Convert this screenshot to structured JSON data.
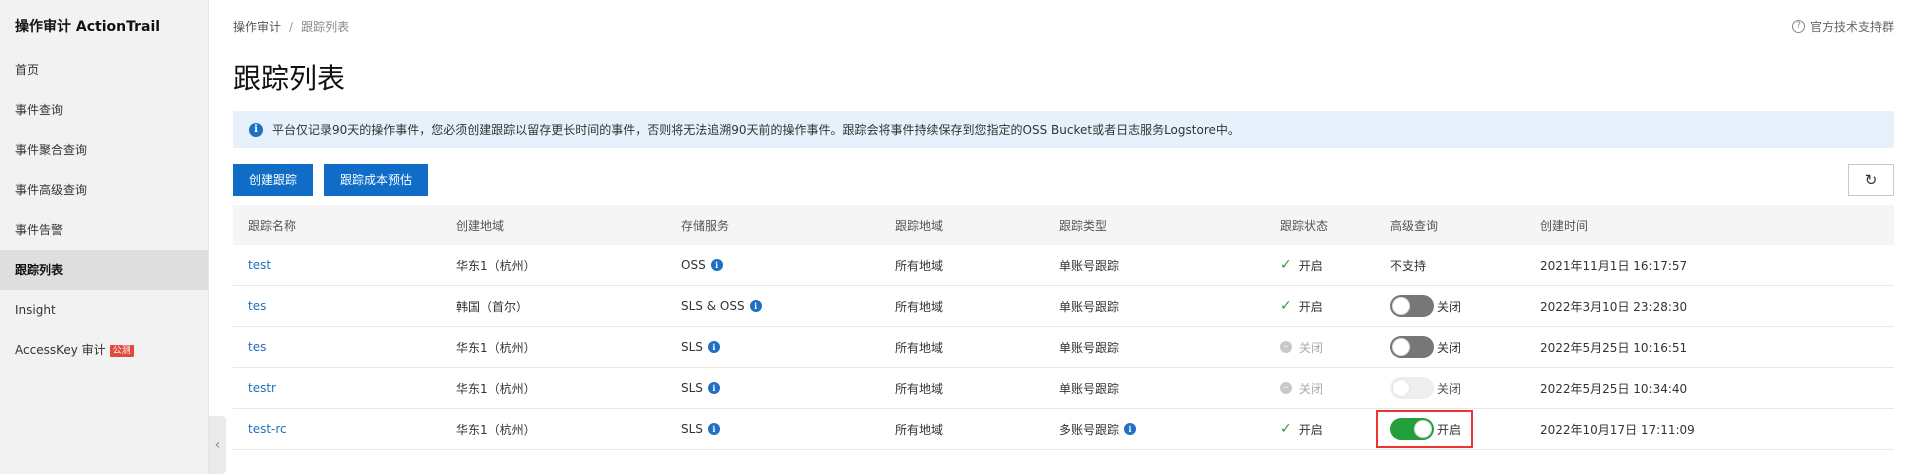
{
  "app": {
    "title": "操作审计 ActionTrail"
  },
  "sidebar": {
    "items": [
      {
        "label": "首页"
      },
      {
        "label": "事件查询"
      },
      {
        "label": "事件聚合查询"
      },
      {
        "label": "事件高级查询"
      },
      {
        "label": "事件告警"
      },
      {
        "label": "跟踪列表",
        "active": true
      },
      {
        "label": "Insight"
      },
      {
        "label": "AccessKey 审计",
        "badge": "公测"
      }
    ]
  },
  "breadcrumb": {
    "root": "操作审计",
    "separator": "/",
    "current": "跟踪列表"
  },
  "support": {
    "label": "官方技术支持群",
    "icon": "question-icon"
  },
  "page": {
    "title": "跟踪列表"
  },
  "notice": {
    "text": "平台仅记录90天的操作事件，您必须创建跟踪以留存更长时间的事件，否则将无法追溯90天前的操作事件。跟踪会将事件持续保存到您指定的OSS Bucket或者日志服务Logstore中。"
  },
  "toolbar": {
    "create_label": "创建跟踪",
    "estimate_label": "跟踪成本预估",
    "refresh_icon": "refresh-icon"
  },
  "table": {
    "headers": [
      "跟踪名称",
      "创建地域",
      "存储服务",
      "跟踪地域",
      "跟踪类型",
      "跟踪状态",
      "高级查询",
      "创建时间"
    ],
    "rows": [
      {
        "name": "test",
        "region": "华东1（杭州）",
        "storage": "OSS",
        "trail_region": "所有地域",
        "type": "单账号跟踪",
        "status": "开启",
        "advanced": "不支持",
        "created": "2021年11月1日 16:17:57"
      },
      {
        "name": "tes",
        "region": "韩国（首尔）",
        "storage": "SLS & OSS",
        "trail_region": "所有地域",
        "type": "单账号跟踪",
        "status": "开启",
        "advanced": "关闭",
        "created": "2022年3月10日 23:28:30"
      },
      {
        "name": "tes",
        "region": "华东1（杭州）",
        "storage": "SLS",
        "trail_region": "所有地域",
        "type": "单账号跟踪",
        "status": "关闭",
        "advanced": "关闭",
        "created": "2022年5月25日 10:16:51"
      },
      {
        "name": "testr",
        "region": "华东1（杭州）",
        "storage": "SLS",
        "trail_region": "所有地域",
        "type": "单账号跟踪",
        "status": "关闭",
        "advanced": "关闭",
        "created": "2022年5月25日 10:34:40"
      },
      {
        "name": "test-rc",
        "region": "华东1（杭州）",
        "storage": "SLS",
        "trail_region": "所有地域",
        "type": "多账号跟踪",
        "status": "开启",
        "advanced": "开启",
        "created": "2022年10月17日 17:11:09"
      }
    ]
  },
  "colors": {
    "primary": "#0f6dc8",
    "success": "#23a03c",
    "notice_bg": "#e6f1fb",
    "highlight": "#e33333"
  }
}
